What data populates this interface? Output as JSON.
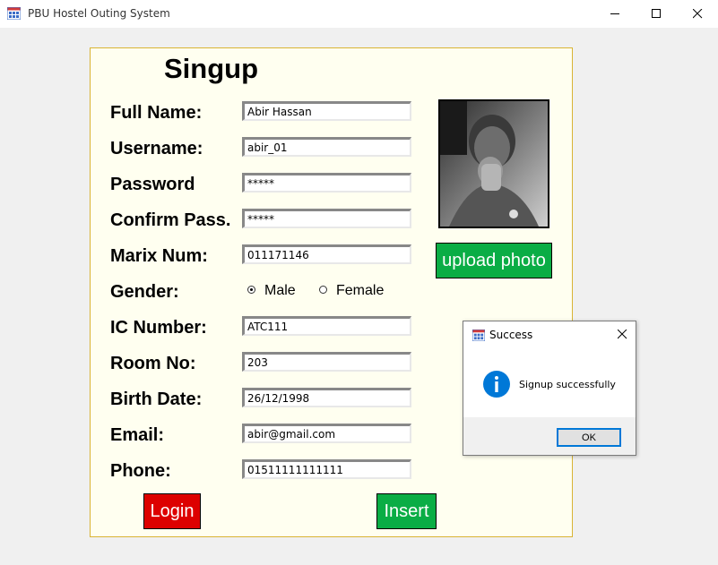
{
  "window": {
    "title": "PBU Hostel Outing System",
    "controls": [
      "minimize",
      "maximize",
      "close"
    ]
  },
  "form": {
    "heading": "Singup",
    "fields": [
      {
        "label": "Full Name:",
        "value": "Abir Hassan"
      },
      {
        "label": "Username:",
        "value": "abir_01"
      },
      {
        "label": "Password",
        "value": "*****"
      },
      {
        "label": "Confirm Pass.",
        "value": "*****"
      },
      {
        "label": "Marix Num:",
        "value": "011171146"
      },
      {
        "label": "IC Number:",
        "value": "ATC111"
      },
      {
        "label": "Room No:",
        "value": "203"
      },
      {
        "label": "Birth Date:",
        "value": "26/12/1998"
      },
      {
        "label": "Email:",
        "value": "abir@gmail.com"
      },
      {
        "label": "Phone:",
        "value": "01511111111111"
      }
    ],
    "gender": {
      "label": "Gender:",
      "options": [
        "Male",
        "Female"
      ],
      "selected": "Male"
    },
    "upload_photo_label": "upload photo",
    "login_label": "Login",
    "insert_label": "Insert"
  },
  "dialog": {
    "title": "Success",
    "message": "Signup successfully",
    "ok_label": "OK",
    "icon": "info-icon"
  },
  "colors": {
    "panel_bg": "#fffff0",
    "panel_border": "#d9b434",
    "green_button": "#0aad45",
    "red_button": "#dd0000",
    "info_blue": "#0078d7"
  }
}
